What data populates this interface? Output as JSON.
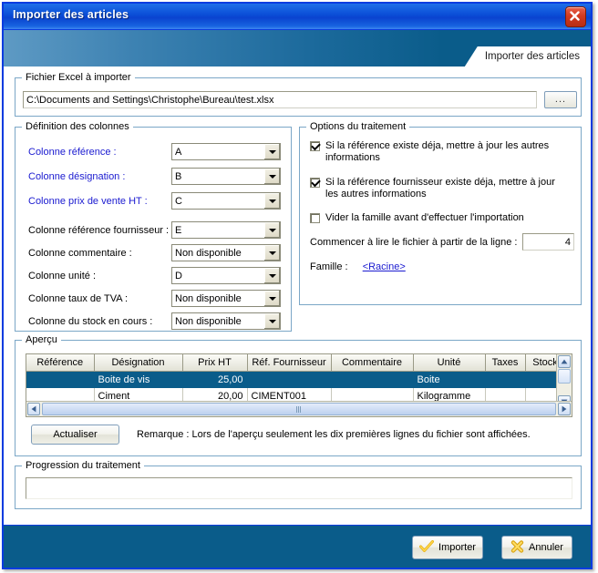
{
  "window": {
    "title": "Importer des articles",
    "close_icon": "close-icon",
    "tab_label": "Importer des articles"
  },
  "file_group": {
    "legend": "Fichier Excel à importer",
    "path_value": "C:\\Documents and Settings\\Christophe\\Bureau\\test.xlsx",
    "path_placeholder": "",
    "browse_label": "..."
  },
  "columns_group": {
    "legend": "Définition des colonnes",
    "rows": [
      {
        "label": "Colonne référence :",
        "value": "A",
        "required": true
      },
      {
        "label": "Colonne désignation :",
        "value": "B",
        "required": true
      },
      {
        "label": "Colonne prix de vente HT :",
        "value": "C",
        "required": true
      },
      {
        "label": "Colonne référence fournisseur :",
        "value": "E",
        "required": false
      },
      {
        "label": "Colonne commentaire :",
        "value": "Non disponible",
        "required": false
      },
      {
        "label": "Colonne unité :",
        "value": "D",
        "required": false
      },
      {
        "label": "Colonne taux de TVA :",
        "value": "Non disponible",
        "required": false
      },
      {
        "label": "Colonne du stock en cours :",
        "value": "Non disponible",
        "required": false
      }
    ]
  },
  "options_group": {
    "legend": "Options du traitement",
    "checkboxes": [
      {
        "label": "Si la référence existe déja, mettre à jour les autres informations",
        "checked": true
      },
      {
        "label": "Si la référence fournisseur existe déja, mettre à jour les autres informations",
        "checked": true
      },
      {
        "label": "Vider la famille avant d'effectuer l'importation",
        "checked": false
      }
    ],
    "start_line_label": "Commencer à lire le fichier à partir de la ligne :",
    "start_line_value": "4",
    "family_label": "Famille :",
    "family_value": "<Racine>"
  },
  "preview_group": {
    "legend": "Aperçu",
    "headers": [
      "Référence",
      "Désignation",
      "Prix HT",
      "Réf. Fournisseur",
      "Commentaire",
      "Unité",
      "Taxes",
      "Stock"
    ],
    "rows": [
      {
        "selected": true,
        "cells": [
          "",
          "Boite de vis",
          "25,00",
          "",
          "",
          "Boite",
          "",
          ""
        ]
      },
      {
        "selected": false,
        "cells": [
          "",
          "Ciment",
          "20,00",
          "CIMENT001",
          "",
          "Kilogramme",
          "",
          ""
        ]
      }
    ],
    "refresh_label": "Actualiser",
    "remark": "Remarque : Lors de l'aperçu seulement les dix premières lignes du fichier sont affichées."
  },
  "progress_group": {
    "legend": "Progression du traitement",
    "value": ""
  },
  "footer": {
    "import_label": "Importer",
    "cancel_label": "Annuler"
  },
  "colors": {
    "accent_blue": "#0a3ce0",
    "banner_dark": "#0a5c8a",
    "required_label": "#1a1ad0",
    "link": "#1a1ad0",
    "selection": "#0a5c8a",
    "close_red": "#d23a20",
    "icon_gold": "#f5c518"
  }
}
